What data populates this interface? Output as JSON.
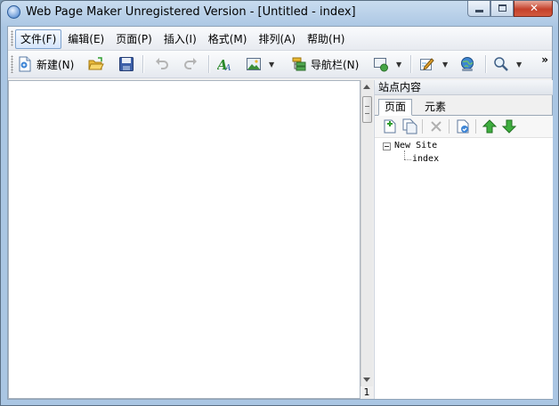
{
  "window": {
    "title": "Web Page Maker Unregistered Version - [Untitled - index]",
    "close_glyph": "✕"
  },
  "menu": {
    "items": [
      "文件(F)",
      "编辑(E)",
      "页面(P)",
      "插入(I)",
      "格式(M)",
      "排列(A)",
      "帮助(H)"
    ]
  },
  "toolbar": {
    "new_label": "新建(N)",
    "navbar_label": "导航栏(N)",
    "overflow": "»"
  },
  "editor": {
    "status_number": "1"
  },
  "panel": {
    "title": "站点内容",
    "tabs": [
      "页面",
      "元素"
    ],
    "tree": {
      "root": "New Site",
      "child": "index"
    }
  },
  "colors": {
    "titlebar": "#c9dcef",
    "close_button": "#c4412b",
    "accent_green": "#2f9e2f"
  }
}
